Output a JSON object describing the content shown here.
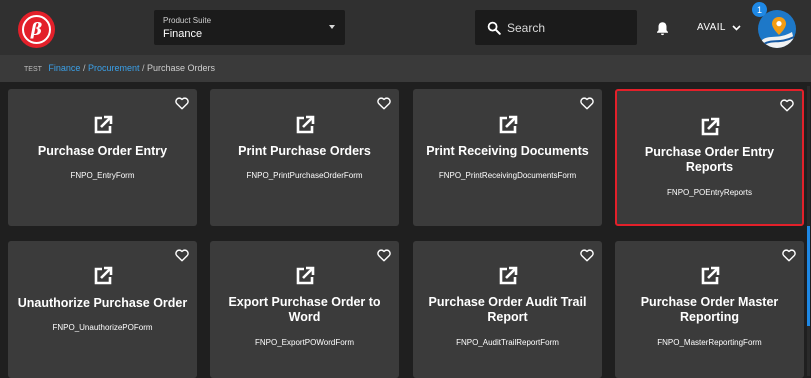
{
  "header": {
    "logo_icon": "beta-logo-icon",
    "product_suite": {
      "label": "Product Suite",
      "value": "Finance"
    },
    "search": {
      "placeholder": "Search"
    },
    "user": {
      "name": "AVAIL",
      "notification_count": "1"
    }
  },
  "breadcrumb": {
    "env": "TEST",
    "items": [
      "Finance",
      "Procurement",
      "Purchase Orders"
    ]
  },
  "tiles": [
    {
      "title": "Purchase Order Entry",
      "form": "FNPO_EntryForm",
      "selected": false
    },
    {
      "title": "Print Purchase Orders",
      "form": "FNPO_PrintPurchaseOrderForm",
      "selected": false
    },
    {
      "title": "Print Receiving Documents",
      "form": "FNPO_PrintReceivingDocumentsForm",
      "selected": false
    },
    {
      "title": "Purchase Order Entry Reports",
      "form": "FNPO_POEntryReports",
      "selected": true
    },
    {
      "title": "Unauthorize Purchase Order",
      "form": "FNPO_UnauthorizePOForm",
      "selected": false
    },
    {
      "title": "Export Purchase Order to Word",
      "form": "FNPO_ExportPOWordForm",
      "selected": false
    },
    {
      "title": "Purchase Order Audit Trail Report",
      "form": "FNPO_AuditTrailReportForm",
      "selected": false
    },
    {
      "title": "Purchase Order Master Reporting",
      "form": "FNPO_MasterReportingForm",
      "selected": false
    }
  ],
  "colors": {
    "accent": "#e3202a",
    "link": "#3aa0e8",
    "tile": "#3b3b3b",
    "background": "#1f1f1f"
  }
}
